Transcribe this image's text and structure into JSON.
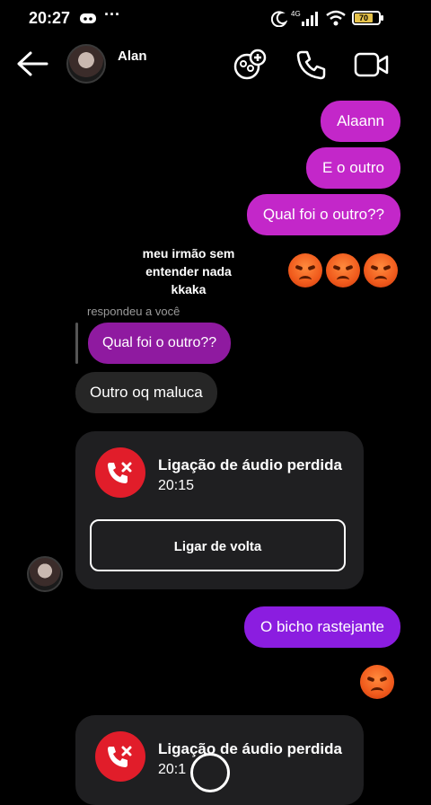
{
  "status_bar": {
    "time": "20:27",
    "battery": "70"
  },
  "header": {
    "contact_name": "Alan"
  },
  "messages": {
    "out1": "Alaann",
    "out2": "E o outro",
    "out3": "Qual foi o outro??",
    "caption": "meu irmão sem entender nada kkaka",
    "reply_label": "respondeu a você",
    "quoted": "Qual foi o outro??",
    "in1": "Outro oq maluca",
    "out4": "O bicho rastejante"
  },
  "calls": [
    {
      "title": "Ligação de áudio perdida",
      "time": "20:15",
      "button": "Ligar de volta"
    },
    {
      "title": "Ligação de áudio perdida",
      "time": "20:1"
    }
  ],
  "colors": {
    "outgoing": "#c327c9",
    "incoming": "#262626",
    "missed_call": "#e11d2a"
  },
  "icons": [
    "back-arrow-icon",
    "add-people-icon",
    "phone-icon",
    "video-icon",
    "moon-icon",
    "signal-icon",
    "wifi-icon",
    "battery-icon",
    "angry-emoji-icon",
    "missed-call-icon"
  ]
}
